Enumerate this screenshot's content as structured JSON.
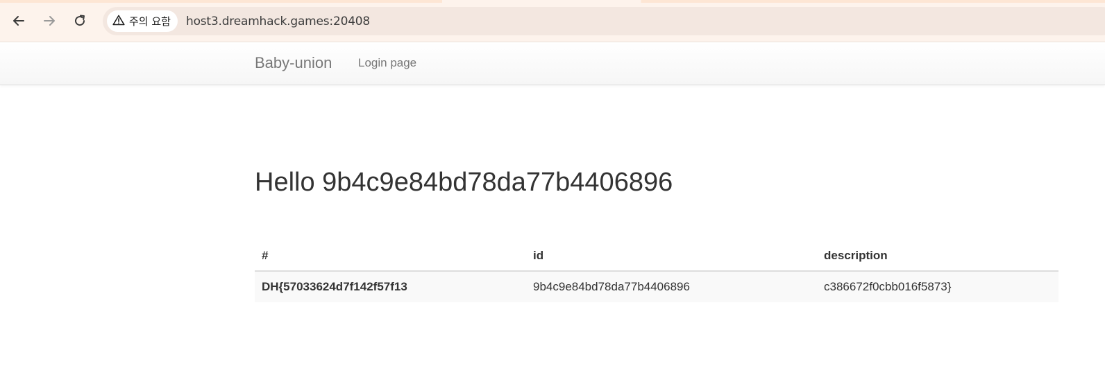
{
  "browser": {
    "security_label": "주의 요함",
    "url": "host3.dreamhack.games:20408",
    "icons": {
      "back": "arrow-left-icon",
      "forward": "arrow-right-icon",
      "reload": "reload-icon",
      "warning": "warning-triangle-icon"
    }
  },
  "navbar": {
    "brand": "Baby-union",
    "links": [
      {
        "label": "Login page"
      }
    ]
  },
  "main": {
    "title": "Hello 9b4c9e84bd78da77b4406896",
    "table": {
      "headers": [
        "#",
        "id",
        "description"
      ],
      "rows": [
        [
          "DH{57033624d7f142f57f13",
          "9b4c9e84bd78da77b4406896",
          "c386672f0cbb016f5873}"
        ]
      ]
    }
  },
  "colors": {
    "browser_bg": "#fdf3ec",
    "omnibox_bg": "#f3e7e0",
    "nav_text": "#777777",
    "body_text": "#333333",
    "row_bg": "#f9f9f9"
  }
}
